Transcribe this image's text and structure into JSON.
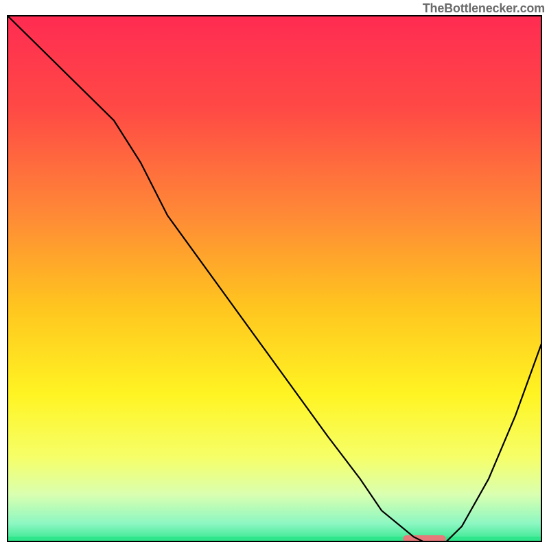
{
  "attribution": "TheBottlenecker.com",
  "chart_data": {
    "type": "line",
    "title": "",
    "xlabel": "",
    "ylabel": "",
    "xlim": [
      0,
      100
    ],
    "ylim": [
      0,
      100
    ],
    "x": [
      0,
      10,
      20,
      25,
      30,
      40,
      50,
      60,
      66,
      70,
      76,
      78,
      82,
      85,
      90,
      95,
      100
    ],
    "values": [
      100,
      90,
      80,
      72,
      62,
      48,
      34,
      20,
      12,
      6,
      1,
      0,
      0,
      3,
      12,
      24,
      38
    ],
    "gradient_stops": [
      {
        "offset": 0.0,
        "color": "#ff2b52"
      },
      {
        "offset": 0.18,
        "color": "#ff4a45"
      },
      {
        "offset": 0.38,
        "color": "#ff8a36"
      },
      {
        "offset": 0.55,
        "color": "#ffc41f"
      },
      {
        "offset": 0.72,
        "color": "#fff423"
      },
      {
        "offset": 0.84,
        "color": "#f6ff69"
      },
      {
        "offset": 0.91,
        "color": "#d9ffb0"
      },
      {
        "offset": 0.965,
        "color": "#8cf7c2"
      },
      {
        "offset": 1.0,
        "color": "#2fe68c"
      }
    ],
    "bottom_bar_color": "#2fe68c",
    "optimal_marker": {
      "x_start": 74,
      "x_end": 82,
      "y": 0,
      "color": "#e67a7a"
    }
  }
}
